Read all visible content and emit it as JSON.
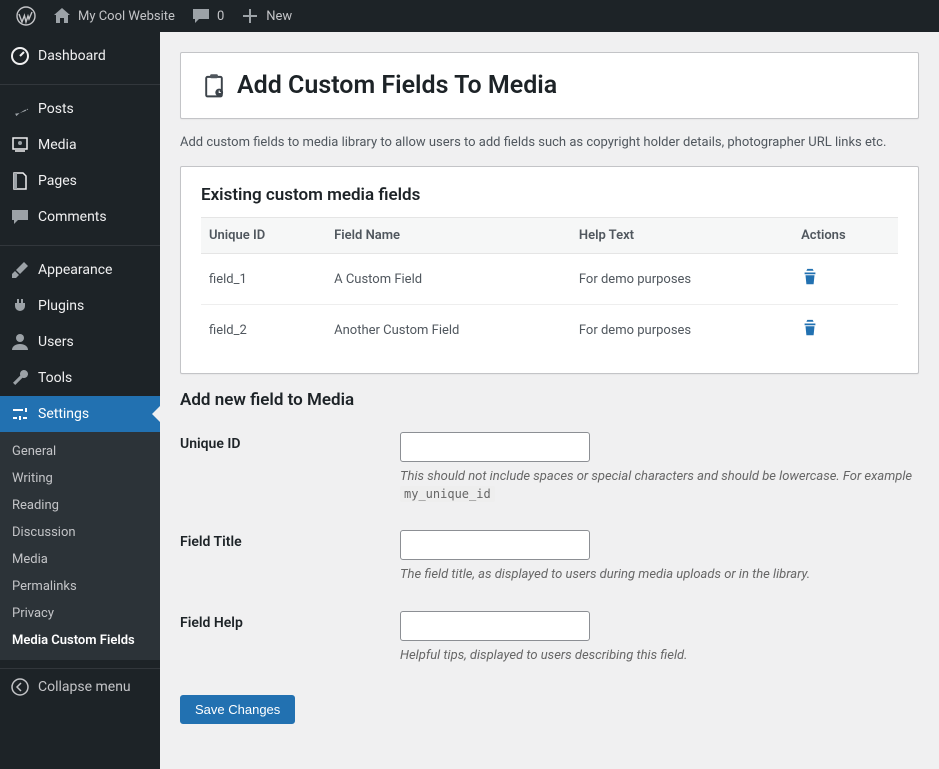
{
  "adminbar": {
    "site_name": "My Cool Website",
    "comments_count": "0",
    "new_label": "New"
  },
  "sidebar": {
    "items": [
      {
        "label": "Dashboard",
        "icon": "dashboard"
      },
      {
        "label": "Posts",
        "icon": "pin"
      },
      {
        "label": "Media",
        "icon": "media"
      },
      {
        "label": "Pages",
        "icon": "page"
      },
      {
        "label": "Comments",
        "icon": "comment"
      },
      {
        "label": "Appearance",
        "icon": "brush"
      },
      {
        "label": "Plugins",
        "icon": "plug"
      },
      {
        "label": "Users",
        "icon": "user"
      },
      {
        "label": "Tools",
        "icon": "wrench"
      },
      {
        "label": "Settings",
        "icon": "sliders",
        "active": true
      }
    ],
    "submenu_settings": [
      {
        "label": "General"
      },
      {
        "label": "Writing"
      },
      {
        "label": "Reading"
      },
      {
        "label": "Discussion"
      },
      {
        "label": "Media"
      },
      {
        "label": "Permalinks"
      },
      {
        "label": "Privacy"
      },
      {
        "label": "Media Custom Fields",
        "current": true
      }
    ],
    "collapse_label": "Collapse menu"
  },
  "page": {
    "title": "Add Custom Fields To Media",
    "description": "Add custom fields to media library to allow users to add fields such as copyright holder details, photographer URL links etc.",
    "existing_heading": "Existing custom media fields",
    "table": {
      "headers": {
        "id": "Unique ID",
        "name": "Field Name",
        "help": "Help Text",
        "actions": "Actions"
      },
      "rows": [
        {
          "id": "field_1",
          "name": "A Custom Field",
          "help": "For demo purposes"
        },
        {
          "id": "field_2",
          "name": "Another Custom Field",
          "help": "For demo purposes"
        }
      ]
    },
    "add_heading": "Add new field to Media",
    "form": {
      "unique_id": {
        "label": "Unique ID",
        "value": "",
        "hint_prefix": "This should not include spaces or special characters and should be lowercase. For example ",
        "hint_code": "my_unique_id"
      },
      "field_title": {
        "label": "Field Title",
        "value": "",
        "hint": "The field title, as displayed to users during media uploads or in the library."
      },
      "field_help": {
        "label": "Field Help",
        "value": "",
        "hint": "Helpful tips, displayed to users describing this field."
      }
    },
    "save_button": "Save Changes"
  }
}
